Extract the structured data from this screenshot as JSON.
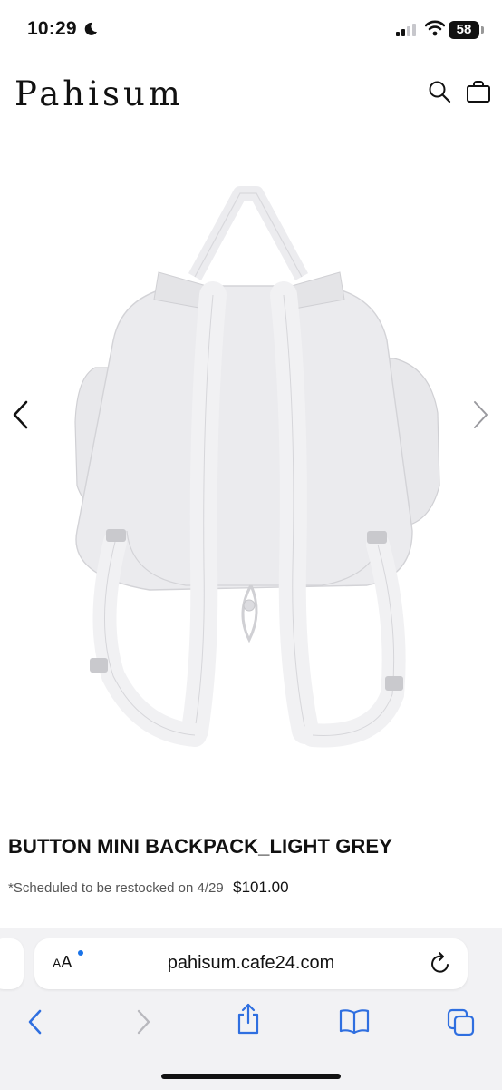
{
  "status_bar": {
    "time": "10:29",
    "battery": "58",
    "icons": [
      "moon-icon",
      "signal-icon",
      "wifi-icon",
      "battery-icon"
    ]
  },
  "header": {
    "logo": "Pahisum",
    "icons": [
      "search-icon",
      "shopping-bag-icon"
    ]
  },
  "gallery": {
    "prev_icon": "chevron-left-icon",
    "next_icon": "chevron-right-icon"
  },
  "product": {
    "name": "BUTTON MINI BACKPACK_LIGHT GREY",
    "restock_note": "*Scheduled to be restocked on 4/29",
    "price": "$101.00"
  },
  "browser": {
    "text_size_label_small": "A",
    "text_size_label_large": "A",
    "url": "pahisum.cafe24.com",
    "toolbar_icons": [
      "back-icon",
      "forward-icon",
      "share-icon",
      "bookmarks-icon",
      "tabs-icon"
    ]
  },
  "colors": {
    "accent": "#1a73e8",
    "toolbar_icon": "#2f6fe0",
    "toolbar_icon_disabled": "#b8b8bd",
    "product_grey": "#e6e6e9"
  }
}
